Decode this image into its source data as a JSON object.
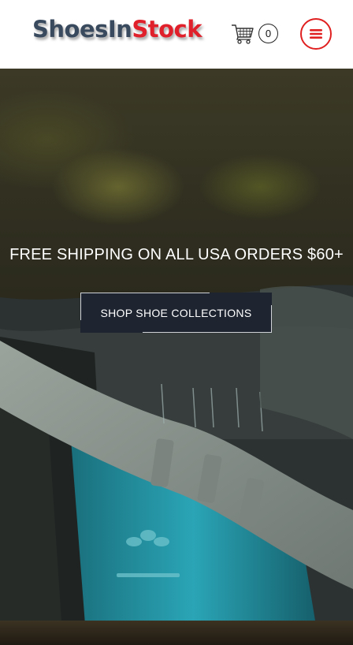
{
  "header": {
    "logo_part1": "ShoesIn",
    "logo_part2": "Stock",
    "cart_count": "0"
  },
  "hero": {
    "headline": "FREE SHIPPING ON ALL USA ORDERS $60+",
    "cta_label": "SHOP SHOE COLLECTIONS"
  },
  "colors": {
    "brand_dark": "#3a4a5e",
    "brand_red": "#e0202a",
    "button_bg": "#1e2531"
  },
  "icons": [
    "shopping-cart-icon",
    "hamburger-menu-icon"
  ]
}
